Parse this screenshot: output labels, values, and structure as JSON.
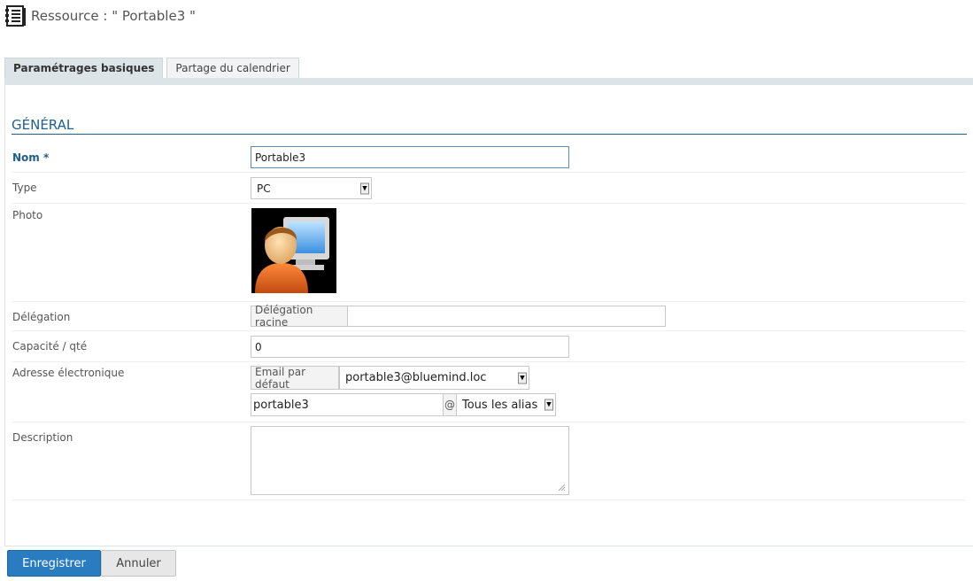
{
  "header": {
    "title": "Ressource : \" Portable3 \"",
    "icon": "resource-icon"
  },
  "tabs": [
    {
      "label": "Paramétrages basiques",
      "active": true
    },
    {
      "label": "Partage du calendrier",
      "active": false
    }
  ],
  "section": {
    "title": "GÉNÉRAL"
  },
  "form": {
    "name": {
      "label": "Nom *",
      "value": "Portable3"
    },
    "type": {
      "label": "Type",
      "value": "PC"
    },
    "photo": {
      "label": "Photo",
      "icon": "user-computer-avatar-icon"
    },
    "delegation": {
      "label": "Délégation",
      "addon": "Délégation racine",
      "value": ""
    },
    "capacity": {
      "label": "Capacité / qté",
      "value": "0"
    },
    "email": {
      "label": "Adresse électronique",
      "addon": "Email par défaut",
      "default_value": "portable3@bluemind.loc",
      "alias_local": "portable3",
      "at": "@",
      "alias_domain": "Tous les alias"
    },
    "description": {
      "label": "Description",
      "value": ""
    }
  },
  "actions": {
    "save": "Enregistrer",
    "cancel": "Annuler"
  },
  "colors": {
    "accent": "#1f5f8b",
    "primary_button": "#2a7cc1",
    "tab_bg": "#dde4e8"
  }
}
